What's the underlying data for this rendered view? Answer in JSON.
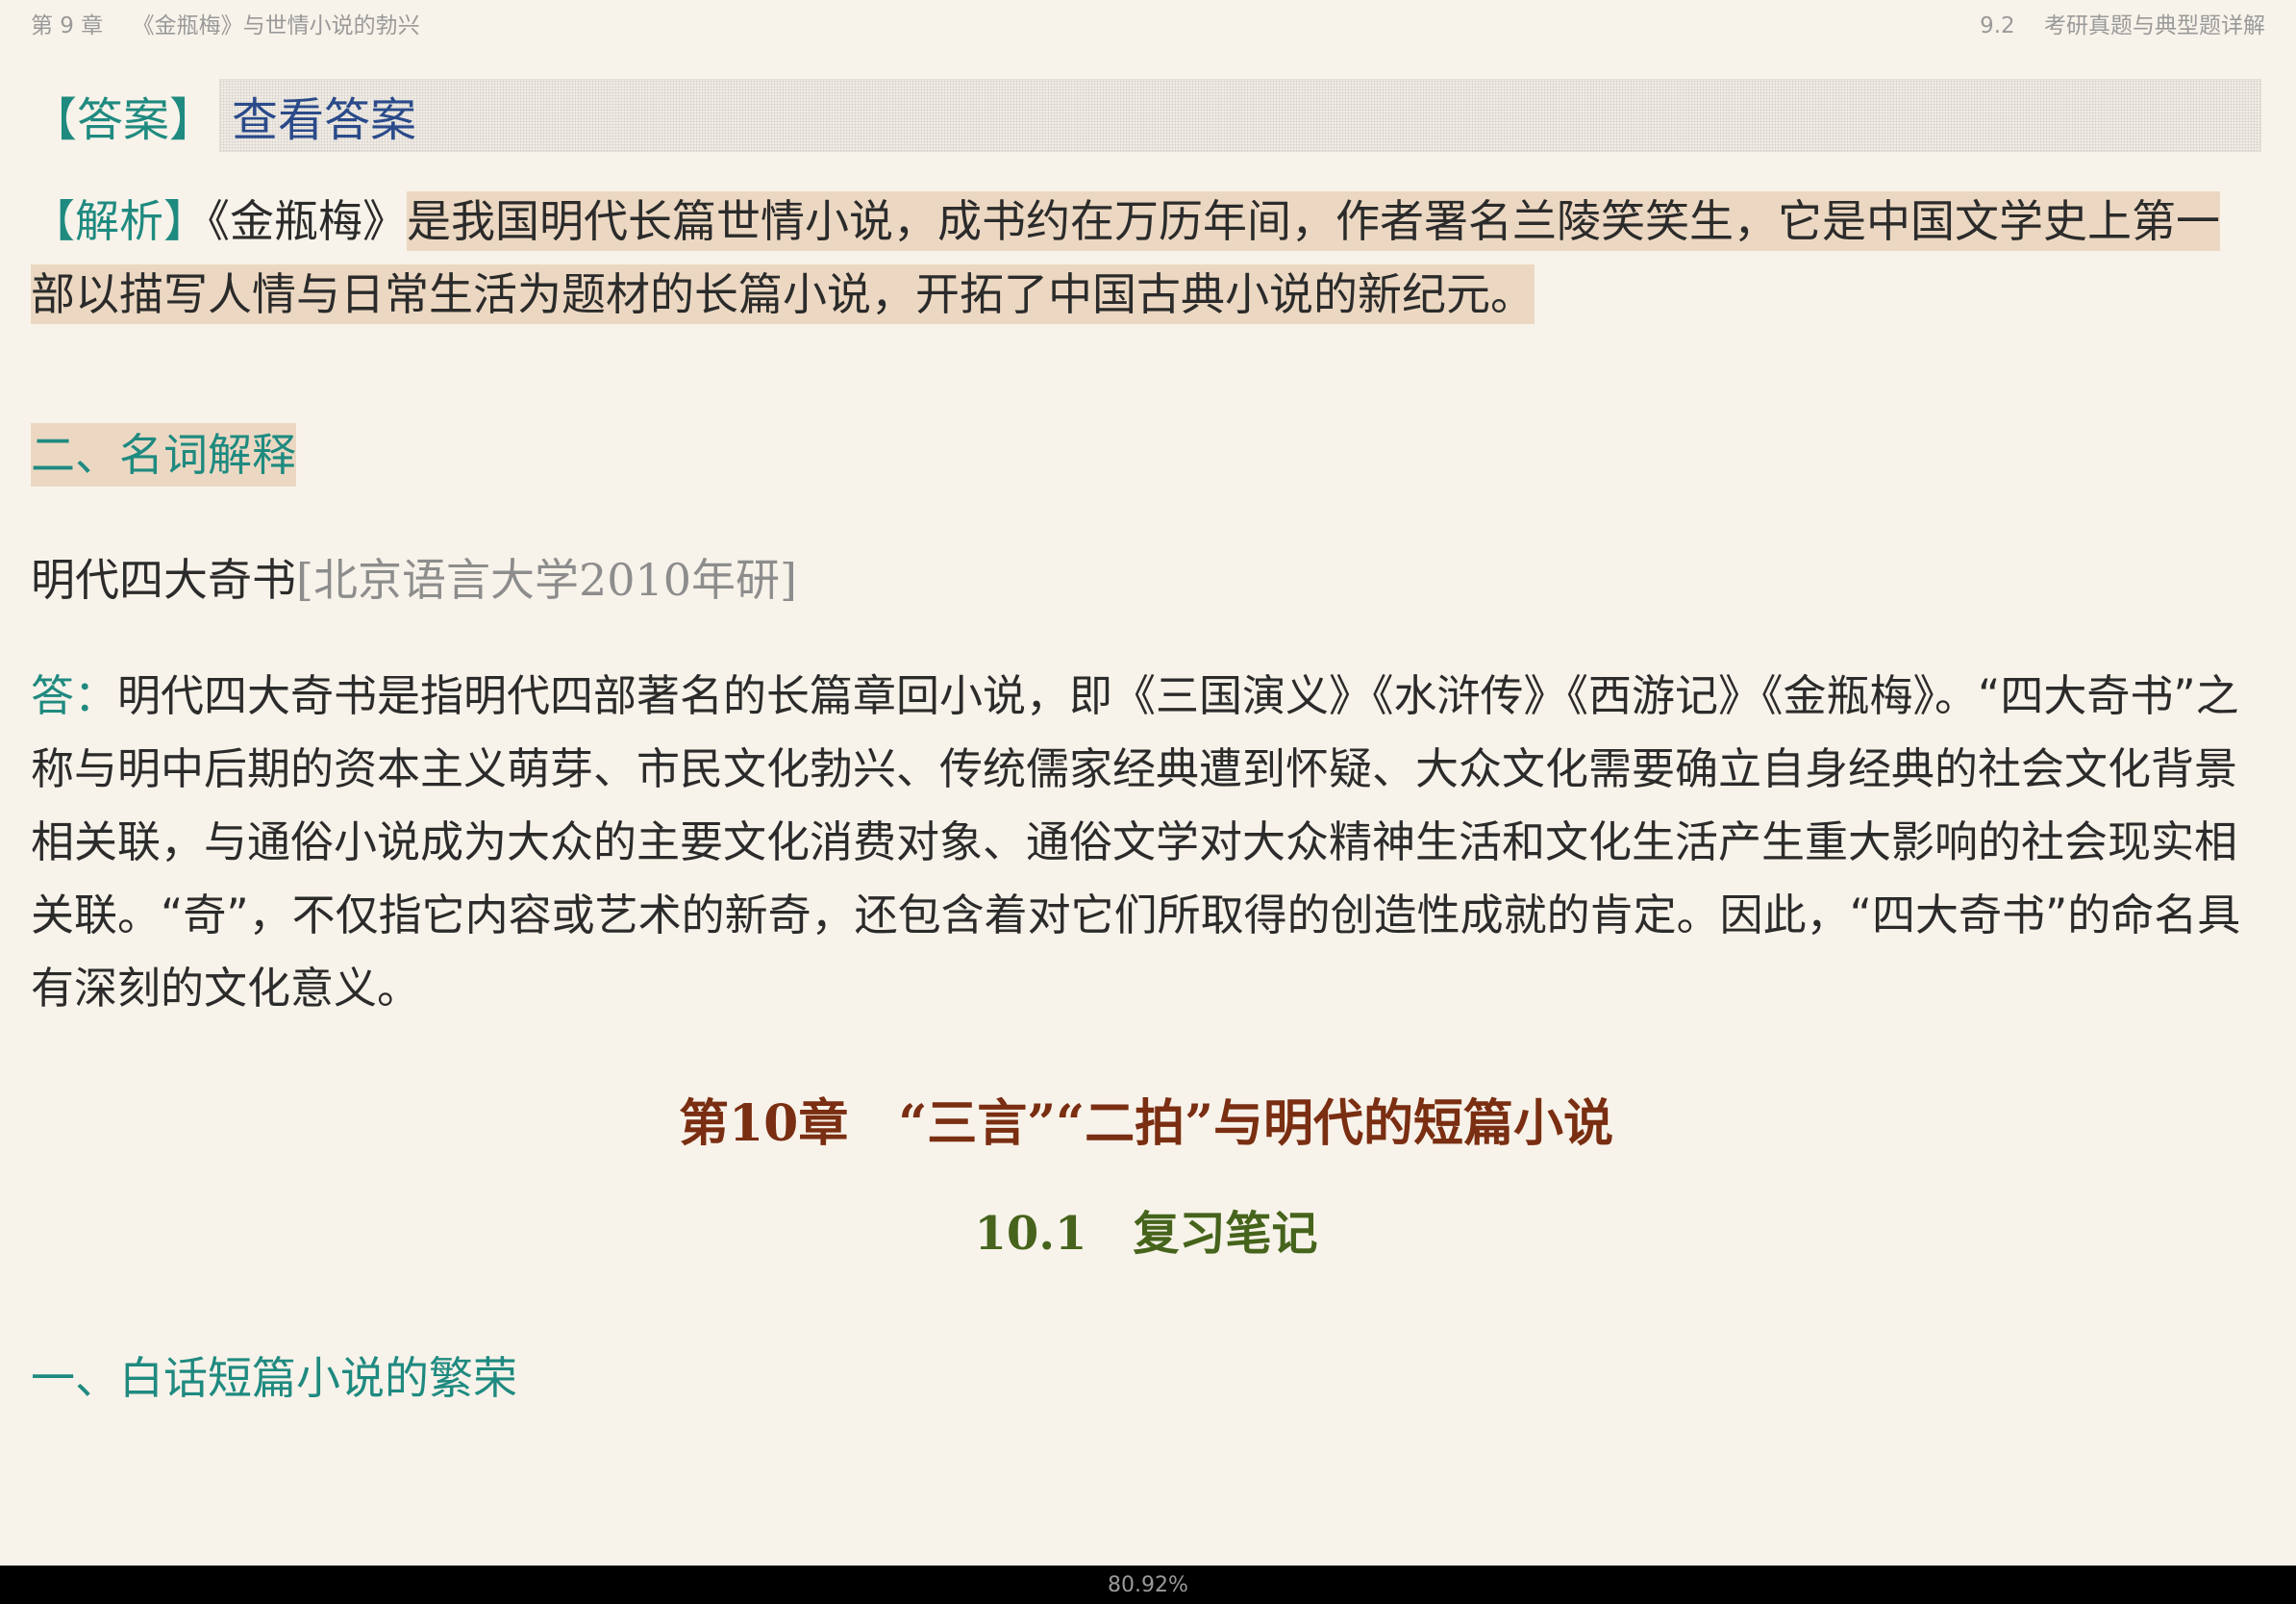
{
  "header": {
    "chapter": "第 9 章",
    "chapter_title": "《金瓶梅》与世情小说的勃兴",
    "section": "9.2",
    "section_title": "考研真题与典型题详解"
  },
  "answer": {
    "label": "【答案】",
    "reveal_text": "查看答案"
  },
  "analysis": {
    "label": "【解析】",
    "book": "《金瓶梅》",
    "text": "是我国明代长篇世情小说，成书约在万历年间，作者署名兰陵笑笑生，它是中国文学史上第一部以描写人情与日常生活为题材的长篇小说，开拓了中国古典小说的新纪元。"
  },
  "section_two": {
    "title": "二、名词解释"
  },
  "term": {
    "name": "明代四大奇书",
    "source": "[北京语言大学2010年研]"
  },
  "term_answer": {
    "label": "答：",
    "text": "明代四大奇书是指明代四部著名的长篇章回小说，即《三国演义》《水浒传》《西游记》《金瓶梅》。“四大奇书”之称与明中后期的资本主义萌芽、市民文化勃兴、传统儒家经典遭到怀疑、大众文化需要确立自身经典的社会文化背景相关联，与通俗小说成为大众的主要文化消费对象、通俗文学对大众精神生活和文化生活产生重大影响的社会现实相关联。“奇”，不仅指它内容或艺术的新奇，还包含着对它们所取得的创造性成就的肯定。因此，“四大奇书”的命名具有深刻的文化意义。"
  },
  "chapter10": {
    "title": "第10章　“三言”“二拍”与明代的短篇小说",
    "subsection": "10.1　复习笔记",
    "heading": "一、白话短篇小说的繁荣"
  },
  "status": {
    "progress": "80.92%"
  },
  "colors": {
    "background": "#f8f3ea",
    "accent_teal": "#1f8a80",
    "highlight": "#ecd8c2",
    "chapter_brown": "#7a2e12",
    "subsection_green": "#46641c",
    "link_blue": "#2a4a8a"
  }
}
